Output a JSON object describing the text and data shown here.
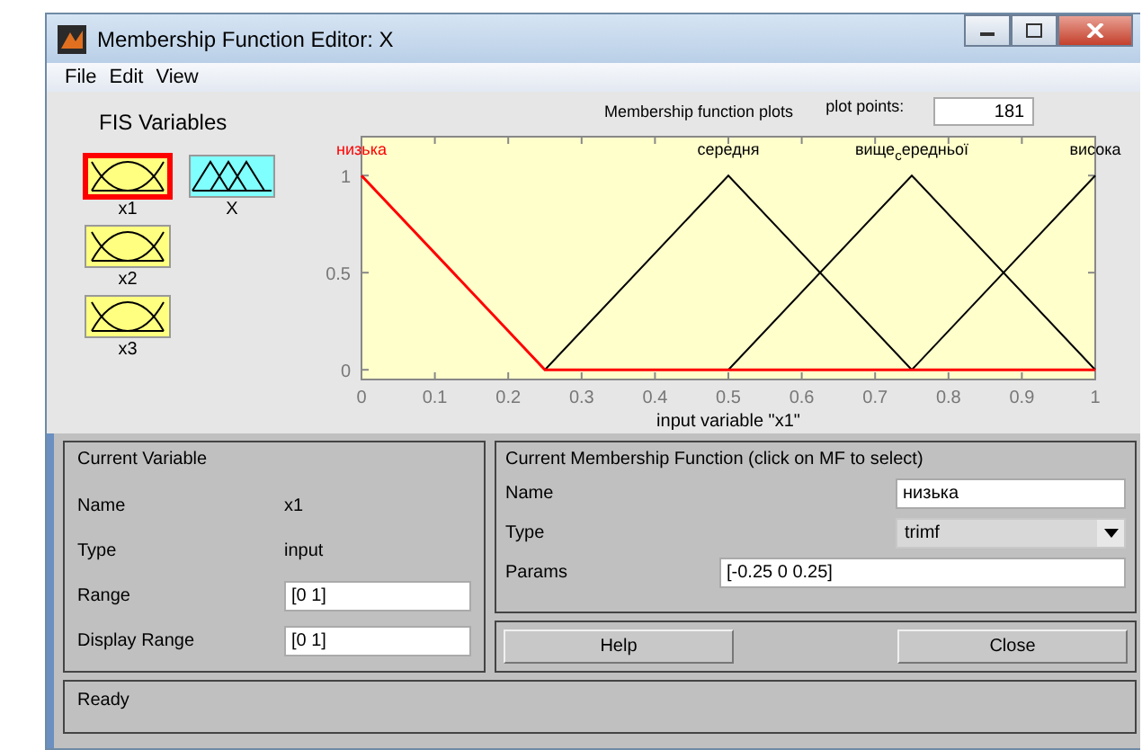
{
  "window": {
    "title": "Membership Function Editor: X"
  },
  "menu": [
    "File",
    "Edit",
    "View"
  ],
  "fis_variables": {
    "title": "FIS Variables",
    "items": [
      {
        "label": "x1",
        "kind": "input",
        "selected": true
      },
      {
        "label": "X",
        "kind": "output",
        "selected": false
      },
      {
        "label": "x2",
        "kind": "input",
        "selected": false
      },
      {
        "label": "x3",
        "kind": "input",
        "selected": false
      }
    ]
  },
  "plot": {
    "plot_points_label": "plot points:",
    "plot_points": "181",
    "chart_data": {
      "type": "line",
      "title": "Membership function plots",
      "xlabel": "input variable \"x1\"",
      "x": [
        0,
        0.25,
        0.5,
        0.75,
        1
      ],
      "series": [
        {
          "name": "низька",
          "color": "#ff0000",
          "values": [
            1,
            0,
            0,
            0,
            0
          ]
        },
        {
          "name": "середня",
          "color": "#000000",
          "values": [
            null,
            0,
            1,
            0,
            null
          ]
        },
        {
          "name": "вище$_{с}$ередньої",
          "color": "#000000",
          "values": [
            null,
            null,
            0,
            1,
            0
          ]
        },
        {
          "name": "висока",
          "color": "#000000",
          "values": [
            null,
            null,
            null,
            0,
            1
          ]
        }
      ],
      "xlim": [
        0,
        1
      ],
      "ylim": [
        -0.05,
        1.2
      ],
      "xticks": [
        0,
        0.1,
        0.2,
        0.3,
        0.4,
        0.5,
        0.6,
        0.7,
        0.8,
        0.9,
        1
      ],
      "yticks": [
        0,
        0.5,
        1
      ]
    }
  },
  "current_variable": {
    "title": "Current Variable",
    "name_label": "Name",
    "name": "x1",
    "type_label": "Type",
    "type": "input",
    "range_label": "Range",
    "range": "[0 1]",
    "display_range_label": "Display Range",
    "display_range": "[0 1]"
  },
  "current_mf": {
    "title": "Current Membership Function (click on MF to select)",
    "name_label": "Name",
    "name": "низька",
    "type_label": "Type",
    "type": "trimf",
    "params_label": "Params",
    "params": "[-0.25 0 0.25]"
  },
  "buttons": [
    "Help",
    "Close"
  ],
  "status": "Ready"
}
